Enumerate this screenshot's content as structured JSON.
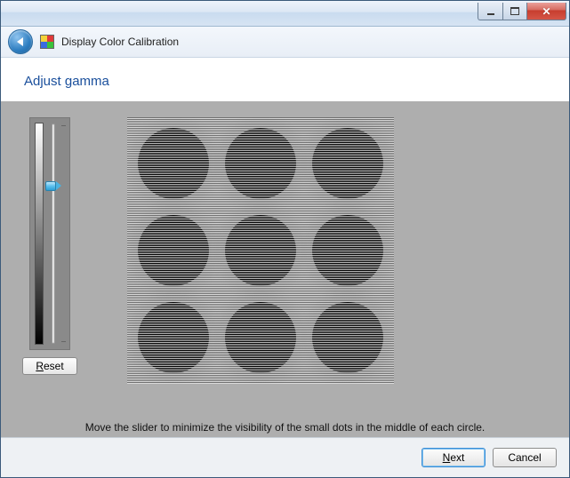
{
  "window": {
    "title": "Display Color Calibration"
  },
  "heading": "Adjust gamma",
  "slider": {
    "value_percent": 27
  },
  "buttons": {
    "reset": "Reset",
    "next": "Next",
    "cancel": "Cancel"
  },
  "instruction": "Move the slider to minimize the visibility of the small dots in the middle of each circle."
}
